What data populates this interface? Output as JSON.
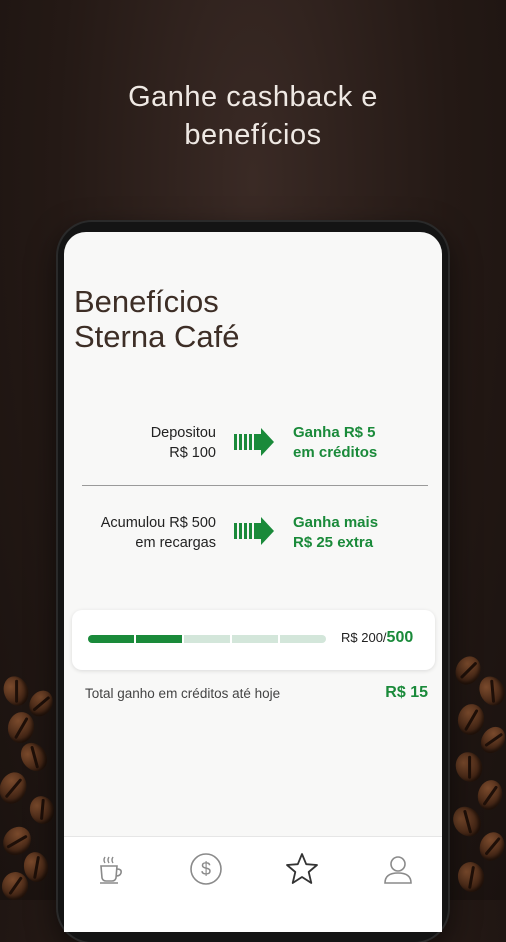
{
  "promo": {
    "line1": "Ganhe cashback e",
    "line2": "benefícios"
  },
  "page": {
    "title_line1": "Benefícios",
    "title_line2": "Sterna Café"
  },
  "rules": [
    {
      "condition_line1": "Depositou",
      "condition_line2": "R$ 100",
      "reward_line1": "Ganha R$ 5",
      "reward_line2": "em créditos"
    },
    {
      "condition_line1": "Acumulou R$ 500",
      "condition_line2": "em recargas",
      "reward_line1": "Ganha mais",
      "reward_line2": "R$ 25 extra"
    }
  ],
  "progress": {
    "current_label": "R$ 200/",
    "goal_label": "500",
    "fraction": 0.4,
    "segments": 5
  },
  "totals": {
    "label": "Total ganho em créditos até hoje",
    "value": "R$ 15"
  },
  "nav": {
    "items": [
      {
        "name": "coffee",
        "icon": "coffee-cup-icon"
      },
      {
        "name": "money",
        "icon": "dollar-coin-icon"
      },
      {
        "name": "benefits",
        "icon": "star-icon",
        "active": true
      },
      {
        "name": "profile",
        "icon": "user-icon"
      }
    ]
  },
  "colors": {
    "accent_green": "#1a8a3a",
    "bar_track": "#d3e6da",
    "title_brown": "#3d2e26"
  }
}
